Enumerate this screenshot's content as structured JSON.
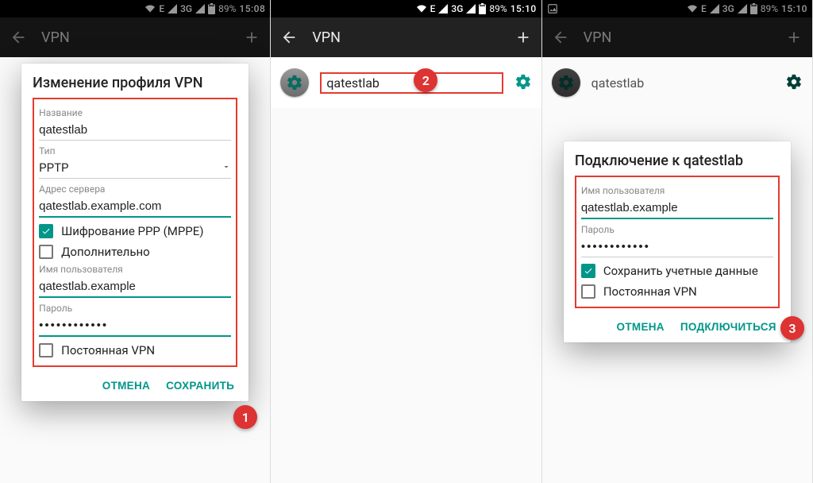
{
  "status": {
    "network": "3G",
    "battery": "89%",
    "time1": "15:08",
    "time2": "15:10",
    "time3": "15:10"
  },
  "appbar": {
    "title": "VPN"
  },
  "vpn_item": {
    "name": "qatestlab"
  },
  "dialog1": {
    "title": "Изменение профиля VPN",
    "name_label": "Название",
    "name_value": "qatestlab",
    "type_label": "Тип",
    "type_value": "PPTP",
    "server_label": "Адрес сервера",
    "server_value": "qatestlab.example.com",
    "ppp_label": "Шифрование PPP (MPPE)",
    "adv_label": "Дополнительно",
    "user_label": "Имя пользователя",
    "user_value": "qatestlab.example",
    "pass_label": "Пароль",
    "pass_value": "••••••••••••",
    "always_label": "Постоянная VPN",
    "cancel": "ОТМЕНА",
    "save": "СОХРАНИТЬ"
  },
  "dialog3": {
    "title": "Подключение к qatestlab",
    "user_label": "Имя пользователя",
    "user_value": "qatestlab.example",
    "pass_label": "Пароль",
    "pass_value": "••••••••••••",
    "remember_label": "Сохранить учетные данные",
    "always_label": "Постоянная VPN",
    "cancel": "ОТМЕНА",
    "connect": "ПОДКЛЮЧИТЬСЯ"
  },
  "badges": {
    "one": "1",
    "two": "2",
    "three": "3"
  },
  "colors": {
    "accent": "#009688",
    "badge": "#d33",
    "highlight": "#e53a2e"
  }
}
